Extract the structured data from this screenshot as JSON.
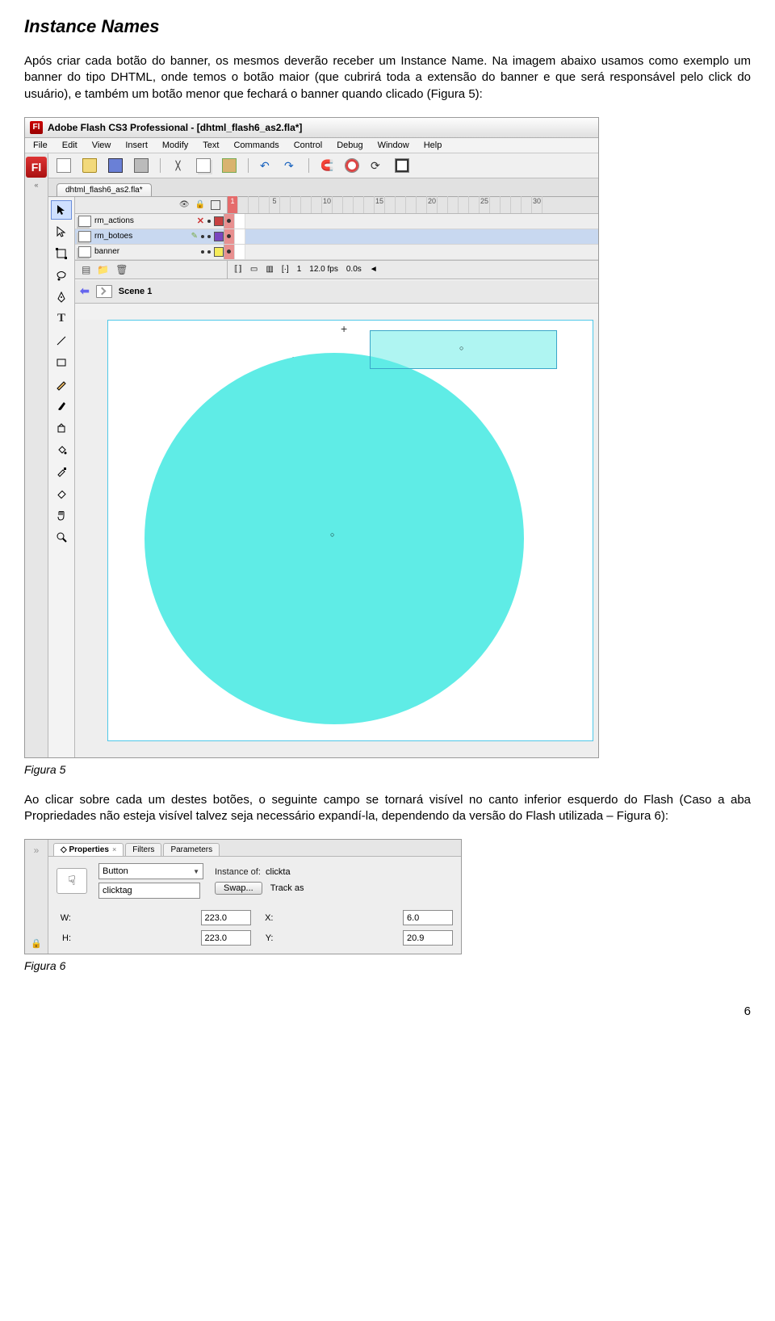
{
  "heading": "Instance Names",
  "para1": "Após criar cada botão do banner, os mesmos deverão receber um Instance Name. Na imagem abaixo usamos como exemplo um banner do tipo DHTML, onde temos o botão maior (que cubrirá toda a extensão do banner e que será responsável pelo click do usuário), e também um botão menor que fechará o banner quando clicado (Figura 5):",
  "figcap5": "Figura 5",
  "para2": "Ao clicar sobre cada um destes botões, o seguinte campo se tornará visível no canto inferior esquerdo do Flash (Caso a aba Propriedades não esteja visível talvez seja necessário expandí-la, dependendo da versão do Flash utilizada – Figura 6):",
  "figcap6": "Figura 6",
  "pageno": "6",
  "flash": {
    "title": "Adobe Flash CS3 Professional - [dhtml_flash6_as2.fla*]",
    "menu": [
      "File",
      "Edit",
      "View",
      "Insert",
      "Modify",
      "Text",
      "Commands",
      "Control",
      "Debug",
      "Window",
      "Help"
    ],
    "doctab": "dhtml_flash6_as2.fla*",
    "frame_numbers": [
      "1",
      "5",
      "10",
      "15",
      "20",
      "25",
      "30"
    ],
    "layers": [
      {
        "name": "rm_actions",
        "color": "red"
      },
      {
        "name": "rm_botoes",
        "color": "purple"
      },
      {
        "name": "banner",
        "color": "yellow"
      }
    ],
    "footer": {
      "frame": "1",
      "fps": "12.0 fps",
      "time": "0.0s"
    },
    "scene": "Scene 1"
  },
  "props": {
    "tabs": [
      "Properties",
      "Filters",
      "Parameters"
    ],
    "type": "Button",
    "instance_label": "Instance of:",
    "instance_of": "clickta",
    "instance_name": "clicktag",
    "swap": "Swap...",
    "track": "Track as",
    "W": "223.0",
    "H": "223.0",
    "X": "6.0",
    "Y": "20.9"
  }
}
